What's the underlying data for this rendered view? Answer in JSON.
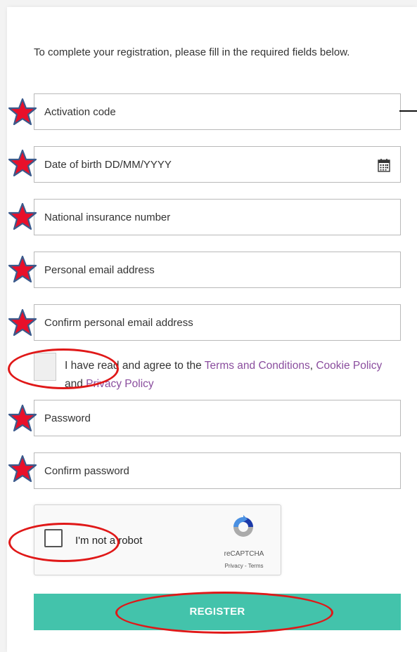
{
  "intro_text": "To complete your registration, please fill in the required fields below.",
  "fields": {
    "activation_code": {
      "placeholder": "Activation code"
    },
    "date_of_birth": {
      "placeholder": "Date of birth DD/MM/YYYY",
      "icon": "calendar-icon"
    },
    "national_insurance": {
      "placeholder": "National insurance number"
    },
    "email": {
      "placeholder": "Personal email address"
    },
    "confirm_email": {
      "placeholder": "Confirm personal email address"
    },
    "password": {
      "placeholder": "Password"
    },
    "confirm_password": {
      "placeholder": "Confirm password"
    }
  },
  "consent": {
    "prefix": "I have read and agree to the ",
    "terms": "Terms and Conditions",
    "sep": ", ",
    "cookie": "Cookie Policy",
    "and": " and ",
    "privacy": "Privacy Policy",
    "checked": false
  },
  "captcha": {
    "label": "I'm not a robot",
    "brand": "reCAPTCHA",
    "links": "Privacy - Terms",
    "icon": "recaptcha-logo-icon"
  },
  "register_label": "REGISTER",
  "colors": {
    "accent": "#43c3ab",
    "link": "#8a4d9e",
    "annotation_red": "#e01818",
    "star_fill": "#e8102a",
    "star_outline": "#3b5a8c"
  },
  "annotations": {
    "required_marker": "star-icon",
    "highlight": "red-ellipse"
  }
}
